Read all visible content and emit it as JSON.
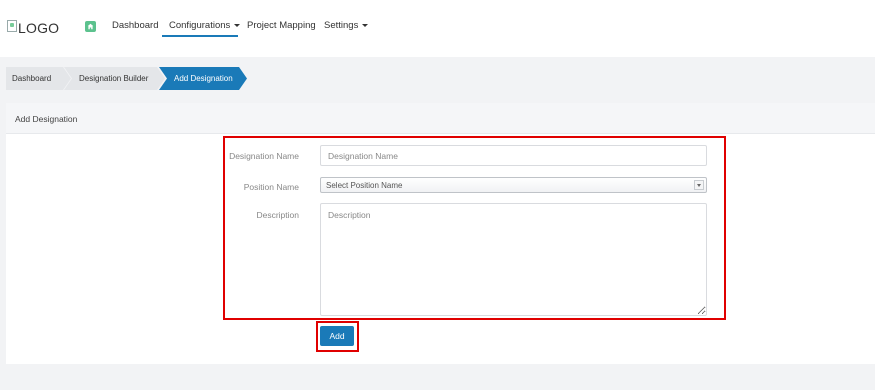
{
  "navbar": {
    "logo_text": "LOGO",
    "items": [
      {
        "label": "Dashboard"
      },
      {
        "label": "Configurations",
        "has_caret": true,
        "active": true
      },
      {
        "label": "Project Mapping"
      },
      {
        "label": "Settings",
        "has_caret": true
      }
    ],
    "home_icon": "home-icon"
  },
  "breadcrumb": [
    {
      "label": "Dashboard"
    },
    {
      "label": "Designation Builder"
    },
    {
      "label": "Add Designation",
      "active": true
    }
  ],
  "panel": {
    "title": "Add Designation"
  },
  "form": {
    "designation_name": {
      "label": "Designation Name",
      "placeholder": "Designation Name",
      "value": ""
    },
    "position_name": {
      "label": "Position Name",
      "selected": "Select Position Name"
    },
    "description": {
      "label": "Description",
      "placeholder": "Description",
      "value": ""
    },
    "submit_label": "Add"
  },
  "colors": {
    "accent": "#1a7ab8",
    "home_icon": "#5cc28e",
    "highlight": "#e00000",
    "breadcrumb_inactive": "#e4e6e9",
    "page_background": "#f2f3f5"
  }
}
